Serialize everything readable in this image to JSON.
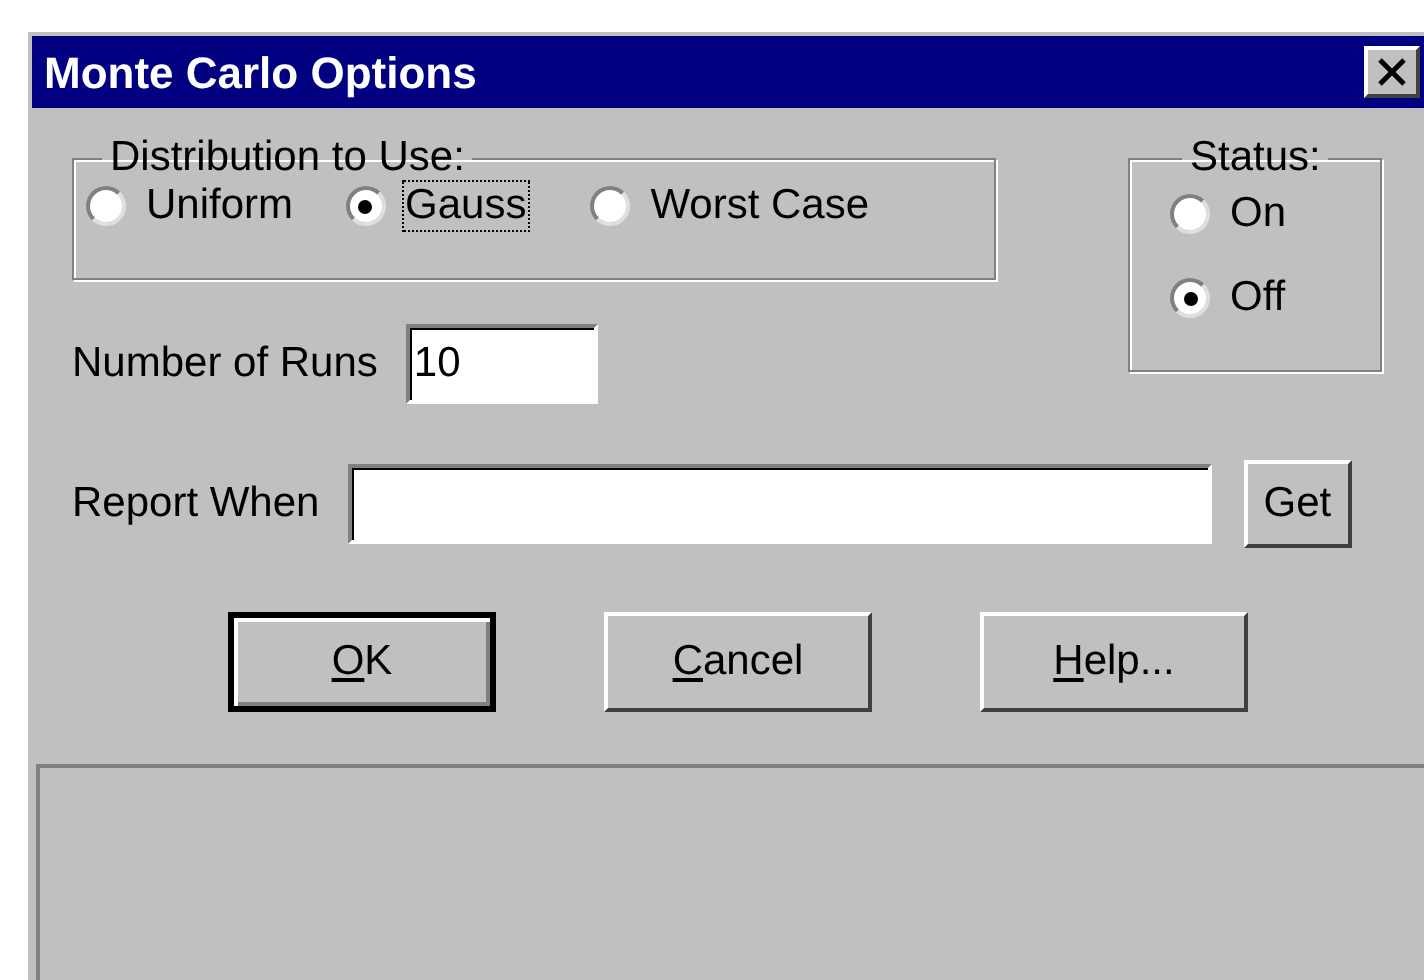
{
  "window": {
    "title": "Monte Carlo Options"
  },
  "distribution": {
    "label": "Distribution to Use:",
    "options": [
      {
        "label": "Uniform",
        "selected": false,
        "focused": false
      },
      {
        "label": "Gauss",
        "selected": true,
        "focused": true
      },
      {
        "label": "Worst Case",
        "selected": false,
        "focused": false
      }
    ]
  },
  "status": {
    "label": "Status:",
    "options": [
      {
        "label": "On",
        "selected": false
      },
      {
        "label": "Off",
        "selected": true
      }
    ]
  },
  "runs": {
    "label": "Number of Runs",
    "value": "10"
  },
  "report_when": {
    "label": "Report When",
    "button": "Get"
  },
  "buttons": [
    {
      "key": "O",
      "rest": "K",
      "default": true
    },
    {
      "key": "C",
      "rest": "ancel",
      "default": false
    },
    {
      "key": "H",
      "rest": "elp...",
      "default": false
    }
  ]
}
